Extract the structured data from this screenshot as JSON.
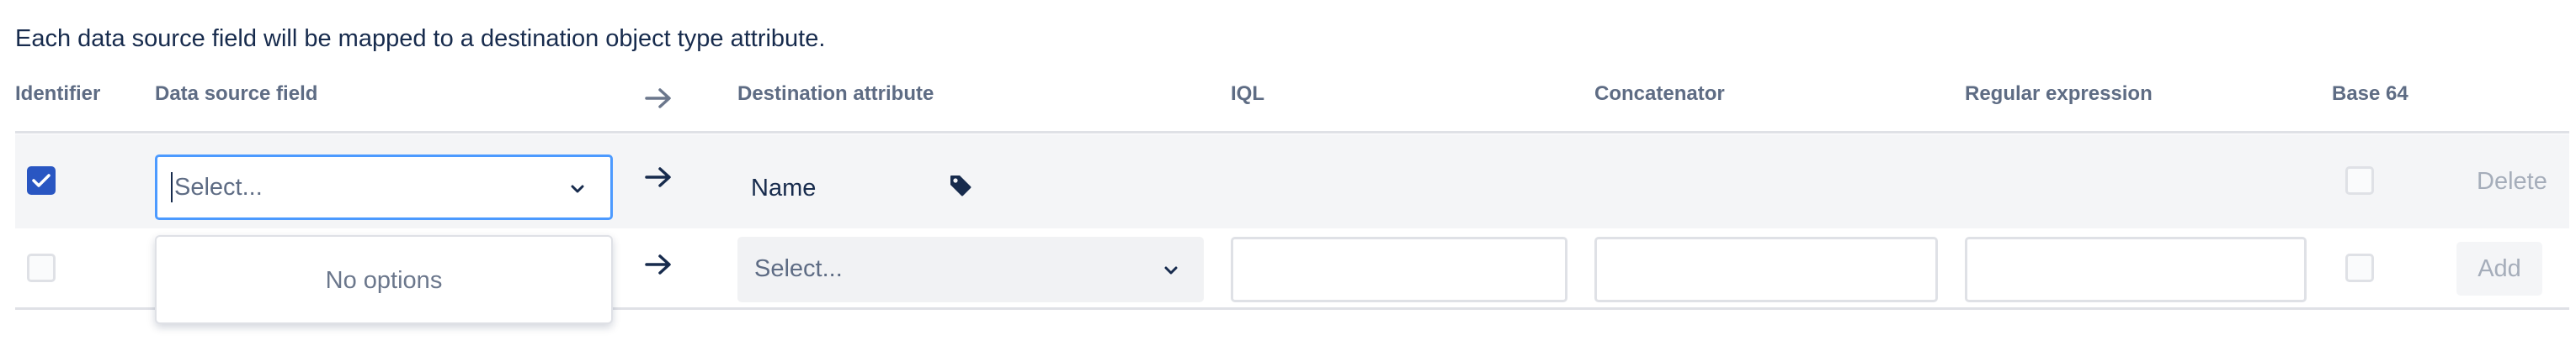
{
  "description": "Each data source field will be mapped to a destination object type attribute.",
  "headers": {
    "identifier": "Identifier",
    "data_source_field": "Data source field",
    "destination_attribute": "Destination attribute",
    "iql": "IQL",
    "concatenator": "Concatenator",
    "regular_expression": "Regular expression",
    "base64": "Base 64"
  },
  "rows": [
    {
      "identifier_checked": true,
      "data_source_placeholder": "Select...",
      "destination_attribute": "Name",
      "destination_icon": "tag-icon",
      "base64_checked": false,
      "action_label": "Delete"
    },
    {
      "identifier_checked": false,
      "destination_placeholder": "Select...",
      "iql_value": "",
      "concatenator_value": "",
      "regex_value": "",
      "base64_checked": false,
      "action_label": "Add"
    }
  ],
  "dropdown": {
    "empty_text": "No options"
  },
  "colors": {
    "accent": "#2956c2",
    "focus_border": "#4c9aff",
    "header_text": "#5e6c84",
    "disabled_text": "#a5adba"
  }
}
